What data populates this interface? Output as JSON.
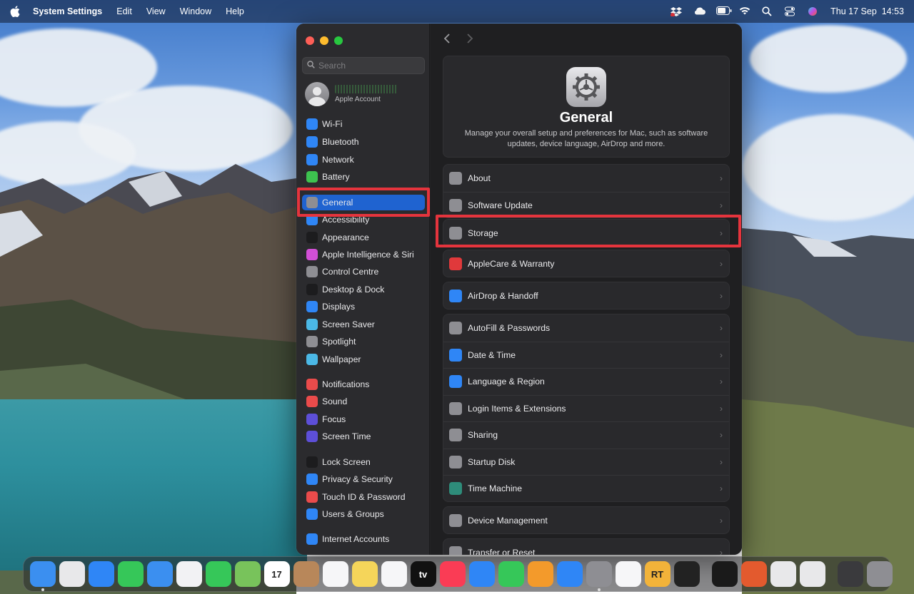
{
  "menubar": {
    "app_name": "System Settings",
    "menus": [
      "Edit",
      "View",
      "Window",
      "Help"
    ],
    "clock": "Thu 17 Sep  14:53"
  },
  "search": {
    "placeholder": "Search"
  },
  "account": {
    "subtitle": "Apple Account"
  },
  "sidebar": {
    "items": [
      {
        "label": "Wi-Fi",
        "icon": "wifi-icon",
        "color": "#2f86f6"
      },
      {
        "label": "Bluetooth",
        "icon": "bluetooth-icon",
        "color": "#2f86f6"
      },
      {
        "label": "Network",
        "icon": "network-icon",
        "color": "#2f86f6"
      },
      {
        "label": "Battery",
        "icon": "battery-icon",
        "color": "#3dc24f"
      },
      {
        "label": "General",
        "icon": "gear-icon",
        "color": "#8e8e93"
      },
      {
        "label": "Accessibility",
        "icon": "accessibility-icon",
        "color": "#2f86f6"
      },
      {
        "label": "Appearance",
        "icon": "appearance-icon",
        "color": "#1c1c1e"
      },
      {
        "label": "Apple Intelligence & Siri",
        "icon": "siri-icon",
        "color": "#d24fd6"
      },
      {
        "label": "Control Centre",
        "icon": "control-centre-icon",
        "color": "#8e8e93"
      },
      {
        "label": "Desktop & Dock",
        "icon": "desktop-dock-icon",
        "color": "#1c1c1e"
      },
      {
        "label": "Displays",
        "icon": "displays-icon",
        "color": "#2f86f6"
      },
      {
        "label": "Screen Saver",
        "icon": "screen-saver-icon",
        "color": "#4bb8e6"
      },
      {
        "label": "Spotlight",
        "icon": "spotlight-icon",
        "color": "#8e8e93"
      },
      {
        "label": "Wallpaper",
        "icon": "wallpaper-icon",
        "color": "#4bb8e6"
      },
      {
        "label": "Notifications",
        "icon": "notifications-icon",
        "color": "#ea4b4b"
      },
      {
        "label": "Sound",
        "icon": "sound-icon",
        "color": "#ea4b4b"
      },
      {
        "label": "Focus",
        "icon": "focus-icon",
        "color": "#5d4fd8"
      },
      {
        "label": "Screen Time",
        "icon": "screen-time-icon",
        "color": "#5d4fd8"
      },
      {
        "label": "Lock Screen",
        "icon": "lock-screen-icon",
        "color": "#1c1c1e"
      },
      {
        "label": "Privacy & Security",
        "icon": "privacy-icon",
        "color": "#2f86f6"
      },
      {
        "label": "Touch ID & Password",
        "icon": "touch-id-icon",
        "color": "#ea4b4b"
      },
      {
        "label": "Users & Groups",
        "icon": "users-groups-icon",
        "color": "#2f86f6"
      },
      {
        "label": "Internet Accounts",
        "icon": "internet-accounts-icon",
        "color": "#2f86f6"
      }
    ]
  },
  "main": {
    "title": "General",
    "description": "Manage your overall setup and preferences for Mac, such as software updates, device language, AirDrop and more.",
    "rows": [
      {
        "label": "About",
        "icon": "about-icon",
        "color": "#8e8e93"
      },
      {
        "label": "Software Update",
        "icon": "software-update-icon",
        "color": "#8e8e93"
      },
      {
        "label": "Storage",
        "icon": "storage-icon",
        "color": "#8e8e93"
      },
      {
        "label": "AppleCare & Warranty",
        "icon": "applecare-icon",
        "color": "#e0393b"
      },
      {
        "label": "AirDrop & Handoff",
        "icon": "airdrop-icon",
        "color": "#2f86f6"
      },
      {
        "label": "AutoFill & Passwords",
        "icon": "autofill-icon",
        "color": "#8e8e93"
      },
      {
        "label": "Date & Time",
        "icon": "date-time-icon",
        "color": "#2f86f6"
      },
      {
        "label": "Language & Region",
        "icon": "language-icon",
        "color": "#2f86f6"
      },
      {
        "label": "Login Items & Extensions",
        "icon": "login-items-icon",
        "color": "#8e8e93"
      },
      {
        "label": "Sharing",
        "icon": "sharing-icon",
        "color": "#8e8e93"
      },
      {
        "label": "Startup Disk",
        "icon": "startup-disk-icon",
        "color": "#8e8e93"
      },
      {
        "label": "Time Machine",
        "icon": "time-machine-icon",
        "color": "#2e8c7a"
      },
      {
        "label": "Device Management",
        "icon": "device-management-icon",
        "color": "#8e8e93"
      },
      {
        "label": "Transfer or Reset",
        "icon": "transfer-reset-icon",
        "color": "#8e8e93"
      }
    ]
  },
  "dock": {
    "apps": [
      {
        "name": "finder-icon",
        "color": "#3b8ff0"
      },
      {
        "name": "launchpad-icon",
        "color": "#e8e8ea"
      },
      {
        "name": "safari-icon",
        "color": "#2f86f6"
      },
      {
        "name": "messages-icon",
        "color": "#36c759"
      },
      {
        "name": "mail-icon",
        "color": "#3b8ff0"
      },
      {
        "name": "photos-icon",
        "color": "#f2f2f4"
      },
      {
        "name": "facetime-icon",
        "color": "#36c759"
      },
      {
        "name": "maps-icon",
        "color": "#78c35b"
      },
      {
        "name": "calendar-icon",
        "color": "#ffffff",
        "text": "17"
      },
      {
        "name": "contacts-icon",
        "color": "#b8875a"
      },
      {
        "name": "reminders-icon",
        "color": "#f6f6f8"
      },
      {
        "name": "notes-icon",
        "color": "#f5d55a"
      },
      {
        "name": "freeform-icon",
        "color": "#f6f6f8"
      },
      {
        "name": "apple-tv-icon",
        "color": "#111111",
        "text": "tv"
      },
      {
        "name": "music-icon",
        "color": "#fa3c55"
      },
      {
        "name": "keynote-icon",
        "color": "#2f86f6"
      },
      {
        "name": "numbers-icon",
        "color": "#36c759"
      },
      {
        "name": "pages-icon",
        "color": "#f39a2b"
      },
      {
        "name": "app-store-icon",
        "color": "#2f86f6"
      },
      {
        "name": "system-settings-icon",
        "color": "#8e8e93"
      },
      {
        "name": "news-icon",
        "color": "#f6f6f8"
      },
      {
        "name": "rt-app-icon",
        "color": "#f2b33a",
        "text": "RT"
      },
      {
        "name": "activity-monitor-icon",
        "color": "#222222"
      },
      {
        "name": "piano-icon",
        "color": "#1a1a1a"
      },
      {
        "name": "surfshark-icon",
        "color": "#e35a2e"
      },
      {
        "name": "shield-app-icon",
        "color": "#e8e8ea"
      },
      {
        "name": "preview-icon",
        "color": "#e8e8ea"
      },
      {
        "name": "keyboard-app-icon",
        "color": "#3a3a3d"
      },
      {
        "name": "trash-icon",
        "color": "#8e8e93"
      }
    ]
  }
}
